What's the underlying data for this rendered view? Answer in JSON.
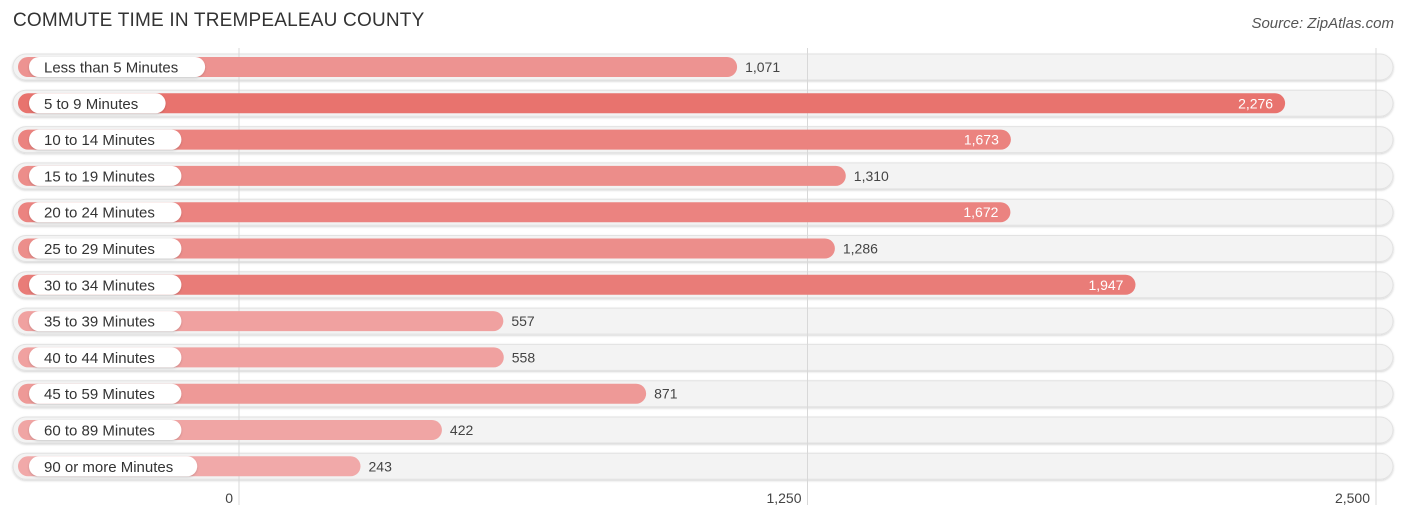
{
  "chart_data": {
    "type": "bar",
    "orientation": "horizontal",
    "title": "COMMUTE TIME IN TREMPEALEAU COUNTY",
    "source": "Source: ZipAtlas.com",
    "xlabel": "",
    "ylabel": "",
    "xlim": [
      0,
      2500
    ],
    "xticks": [
      0,
      1250,
      2500
    ],
    "xtick_labels": [
      "0",
      "1,250",
      "2,500"
    ],
    "grid": true,
    "categories": [
      "Less than 5 Minutes",
      "5 to 9 Minutes",
      "10 to 14 Minutes",
      "15 to 19 Minutes",
      "20 to 24 Minutes",
      "25 to 29 Minutes",
      "30 to 34 Minutes",
      "35 to 39 Minutes",
      "40 to 44 Minutes",
      "45 to 59 Minutes",
      "60 to 89 Minutes",
      "90 or more Minutes"
    ],
    "values": [
      1071,
      2276,
      1673,
      1310,
      1672,
      1286,
      1947,
      557,
      558,
      871,
      422,
      243
    ],
    "value_labels": [
      "1,071",
      "2,276",
      "1,673",
      "1,310",
      "1,672",
      "1,286",
      "1,947",
      "557",
      "558",
      "871",
      "422",
      "243"
    ],
    "colors": {
      "strong": "#e8736e",
      "light": "#f2b0b0",
      "track": "#f3f3f3"
    }
  }
}
